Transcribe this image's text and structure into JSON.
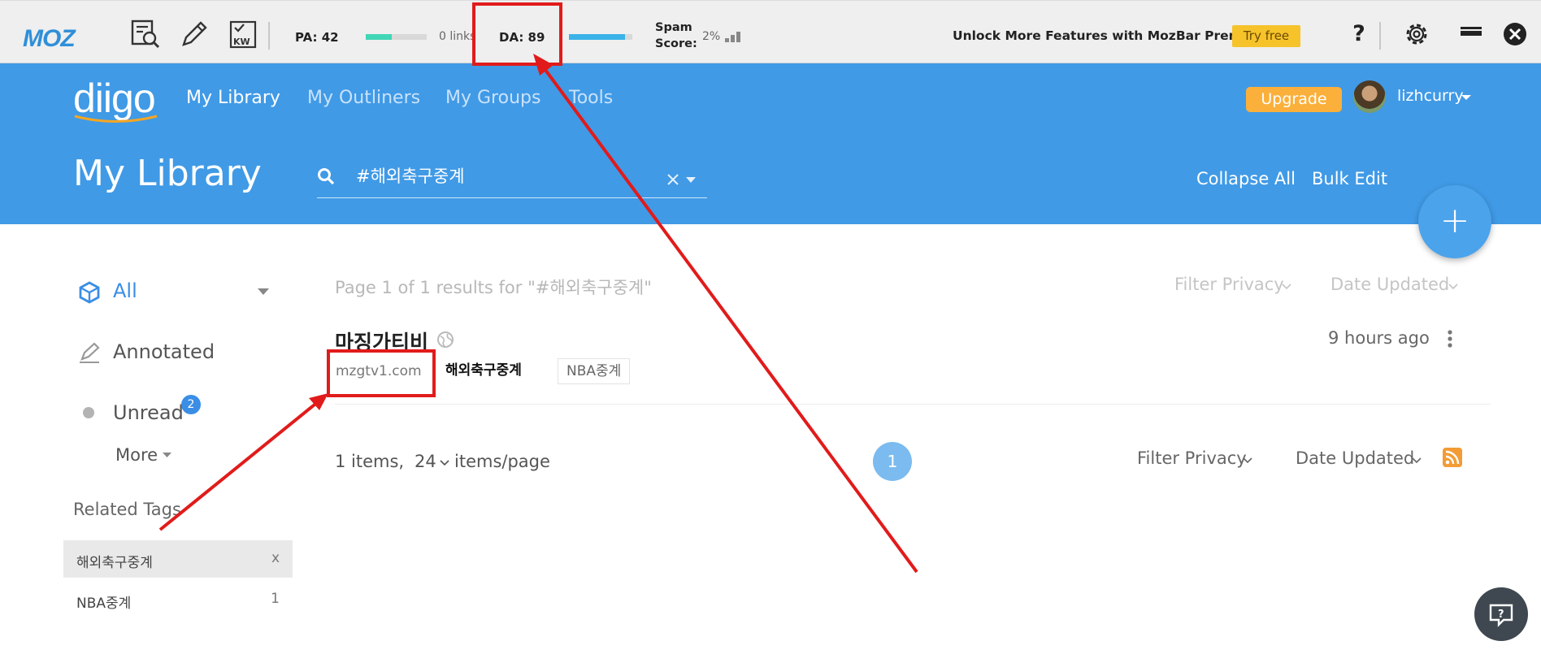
{
  "mozbar": {
    "logo": "MOZ",
    "pa_label": "PA: 42",
    "links_label": "0 links",
    "da_label": "DA: 89",
    "spam_label_1": "Spam",
    "spam_label_2": "Score:",
    "spam_value": "2%",
    "pa_progress": 0.42,
    "da_progress": 0.89,
    "promo": "Unlock More Features with MozBar Premium",
    "try_free": "Try free",
    "help": "?"
  },
  "header": {
    "logo": "diigo",
    "nav": [
      "My Library",
      "My Outliners",
      "My Groups",
      "Tools"
    ],
    "upgrade": "Upgrade",
    "username": "lizhcurry",
    "page_title": "My Library",
    "search_value": "#해외축구중계",
    "collapse_all": "Collapse All",
    "bulk_edit": "Bulk Edit",
    "fab": "+"
  },
  "sidebar": {
    "all": "All",
    "annotated": "Annotated",
    "unread": "Unread",
    "unread_count": "2",
    "more": "More",
    "related_title": "Related Tags",
    "tags": [
      {
        "name": "해외축구중계",
        "right": "x"
      },
      {
        "name": "NBA중계",
        "right": "1"
      }
    ]
  },
  "main": {
    "results_info": "Page 1 of 1 results for \"#해외축구중계\"",
    "filter_privacy": "Filter Privacy",
    "date_updated": "Date Updated",
    "item": {
      "title": "마징가티비",
      "url": "mzgtv1.com",
      "tags": [
        "해외축구중계",
        "NBA중계"
      ],
      "time": "9 hours ago"
    },
    "footer": {
      "items": "1 items,",
      "per_page": "24",
      "per_page_suffix": "items/page",
      "page": "1",
      "filter_privacy": "Filter Privacy",
      "date_updated": "Date Updated"
    }
  },
  "colors": {
    "header_blue": "#409ae6",
    "annotation_red": "#e11b1b",
    "upgrade_orange": "#fbb03b",
    "moz_blue": "#2f8fd8"
  }
}
